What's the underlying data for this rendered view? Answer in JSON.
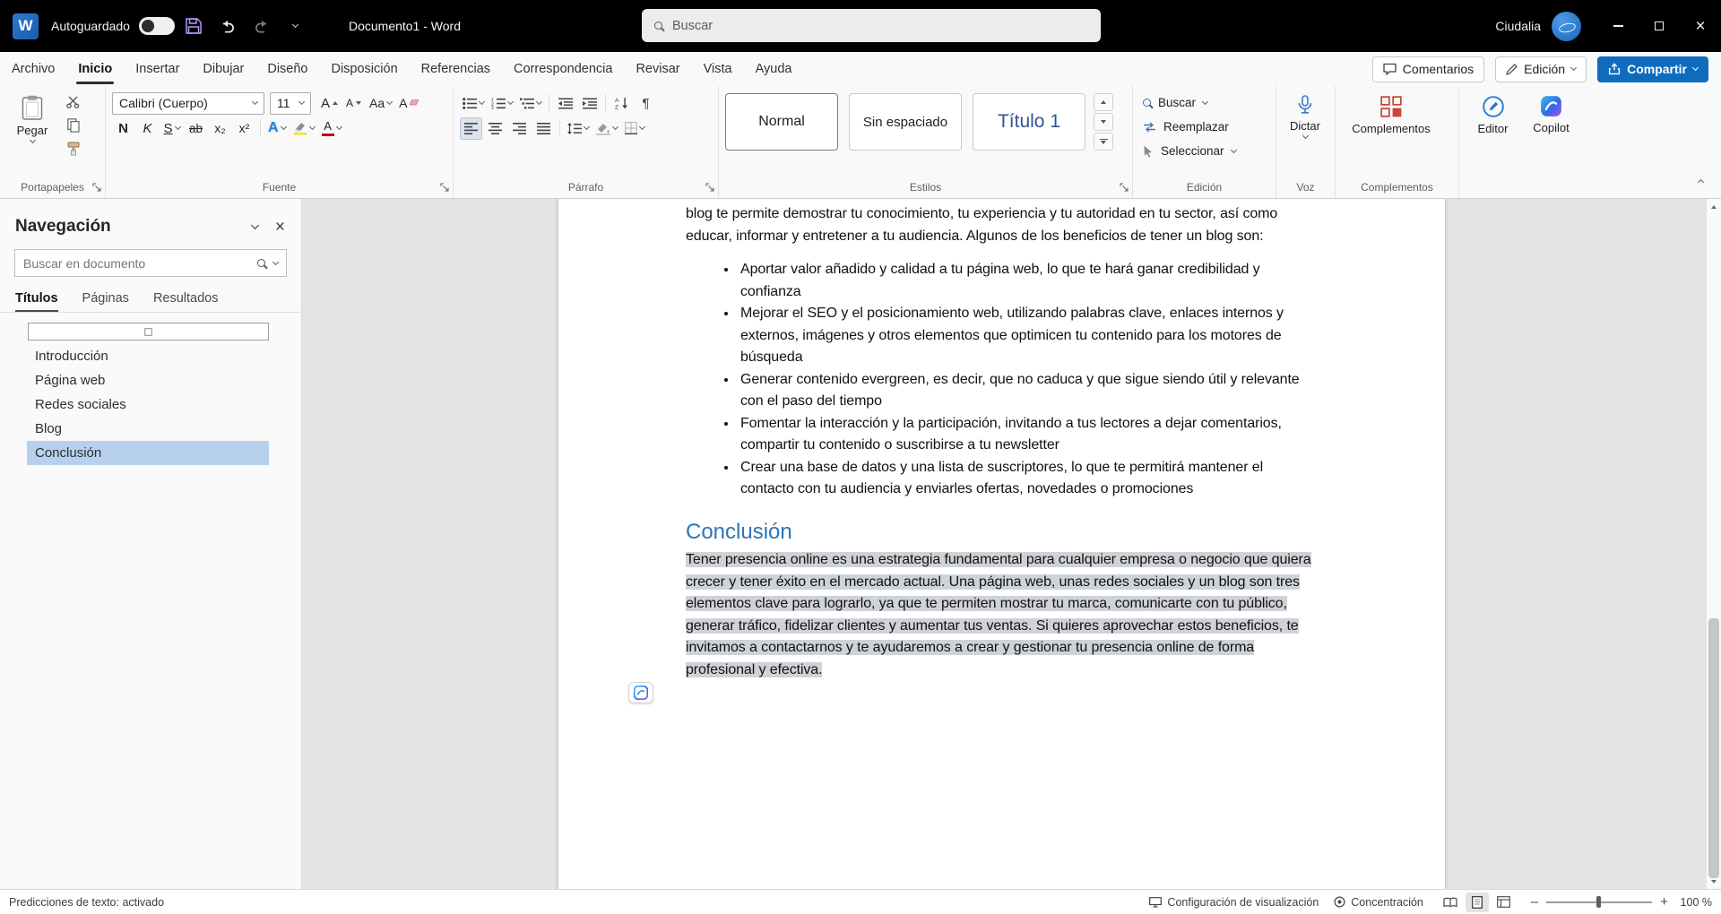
{
  "colors": {
    "accent_blue": "#0f6cbd",
    "titlebar_bg": "#000000",
    "document_heading_blue": "#2e74b5",
    "style_heading_blue": "#2f5496",
    "selection_highlight": "#c9ced4",
    "nav_selected_bg": "#b7d0ee",
    "font_color_swatch": "#c00000",
    "highlight_swatch": "#f3e52b"
  },
  "titlebar": {
    "autosave_label": "Autoguardado",
    "document_title": "Documento1 - Word",
    "search_placeholder": "Buscar",
    "user_name": "Ciudalia"
  },
  "tabs": {
    "items": [
      "Archivo",
      "Inicio",
      "Insertar",
      "Dibujar",
      "Diseño",
      "Disposición",
      "Referencias",
      "Correspondencia",
      "Revisar",
      "Vista",
      "Ayuda"
    ],
    "active_tab": "Inicio",
    "comments_button": "Comentarios",
    "editing_button": "Edición",
    "share_button": "Compartir"
  },
  "ribbon": {
    "paste_label": "Pegar",
    "clipboard_group_label": "Portapapeles",
    "font_name_value": "Calibri (Cuerpo)",
    "font_size_value": "11",
    "bold": "N",
    "italic": "K",
    "underline": "S",
    "strikethrough": "ab",
    "subscript": "x₂",
    "superscript": "x²",
    "grow_font": "A",
    "shrink_font": "A",
    "change_case": "Aa",
    "clear_format": "A",
    "text_effects": "A",
    "font_color": "A",
    "font_group_label": "Fuente",
    "paragraph_mark": "¶",
    "paragraph_group_label": "Párrafo",
    "styles": [
      "Normal",
      "Sin espaciado",
      "Título 1"
    ],
    "styles_group_label": "Estilos",
    "find_label": "Buscar",
    "replace_label": "Reemplazar",
    "select_label": "Seleccionar",
    "editing_group_label": "Edición",
    "dictate_label": "Dictar",
    "voice_group_label": "Voz",
    "addins_label": "Complementos",
    "addins_group_label": "Complementos",
    "editor_label": "Editor",
    "copilot_label": "Copilot"
  },
  "navigation": {
    "title": "Navegación",
    "search_placeholder": "Buscar en documento",
    "tabs": [
      "Títulos",
      "Páginas",
      "Resultados"
    ],
    "active_tab": "Títulos",
    "headings": [
      "Introducción",
      "Página web",
      "Redes sociales",
      "Blog",
      "Conclusión"
    ],
    "selected_heading": "Conclusión"
  },
  "document": {
    "intro_paragraph": "blog te permite demostrar tu conocimiento, tu experiencia y tu autoridad en tu sector, así como educar, informar y entretener a tu audiencia. Algunos de los beneficios de tener un blog son:",
    "bullets": [
      "Aportar valor añadido y calidad a tu página web, lo que te hará ganar credibilidad y confianza",
      "Mejorar el SEO y el posicionamiento web, utilizando palabras clave, enlaces internos y externos, imágenes y otros elementos que optimicen tu contenido para los motores de búsqueda",
      "Generar contenido evergreen, es decir, que no caduca y que sigue siendo útil y relevante con el paso del tiempo",
      "Fomentar la interacción y la participación, invitando a tus lectores a dejar comentarios, compartir tu contenido o suscribirse a tu newsletter",
      "Crear una base de datos y una lista de suscriptores, lo que te permitirá mantener el contacto con tu audiencia y enviarles ofertas, novedades o promociones"
    ],
    "heading": "Conclusión",
    "conclusion_paragraph": "Tener presencia online es una estrategia fundamental para cualquier empresa o negocio que quiera crecer y tener éxito en el mercado actual. Una página web, unas redes sociales y un blog son tres elementos clave para lograrlo, ya que te permiten mostrar tu marca, comunicarte con tu público, generar tráfico, fidelizar clientes y aumentar tus ventas. Si quieres aprovechar estos beneficios, te invitamos a contactarnos y te ayudaremos a crear y gestionar tu presencia online de forma profesional y efectiva."
  },
  "statusbar": {
    "left_text": "Predicciones de texto: activado",
    "display_settings_label": "Configuración de visualización",
    "focus_label": "Concentración",
    "zoom_value": "100 %"
  }
}
